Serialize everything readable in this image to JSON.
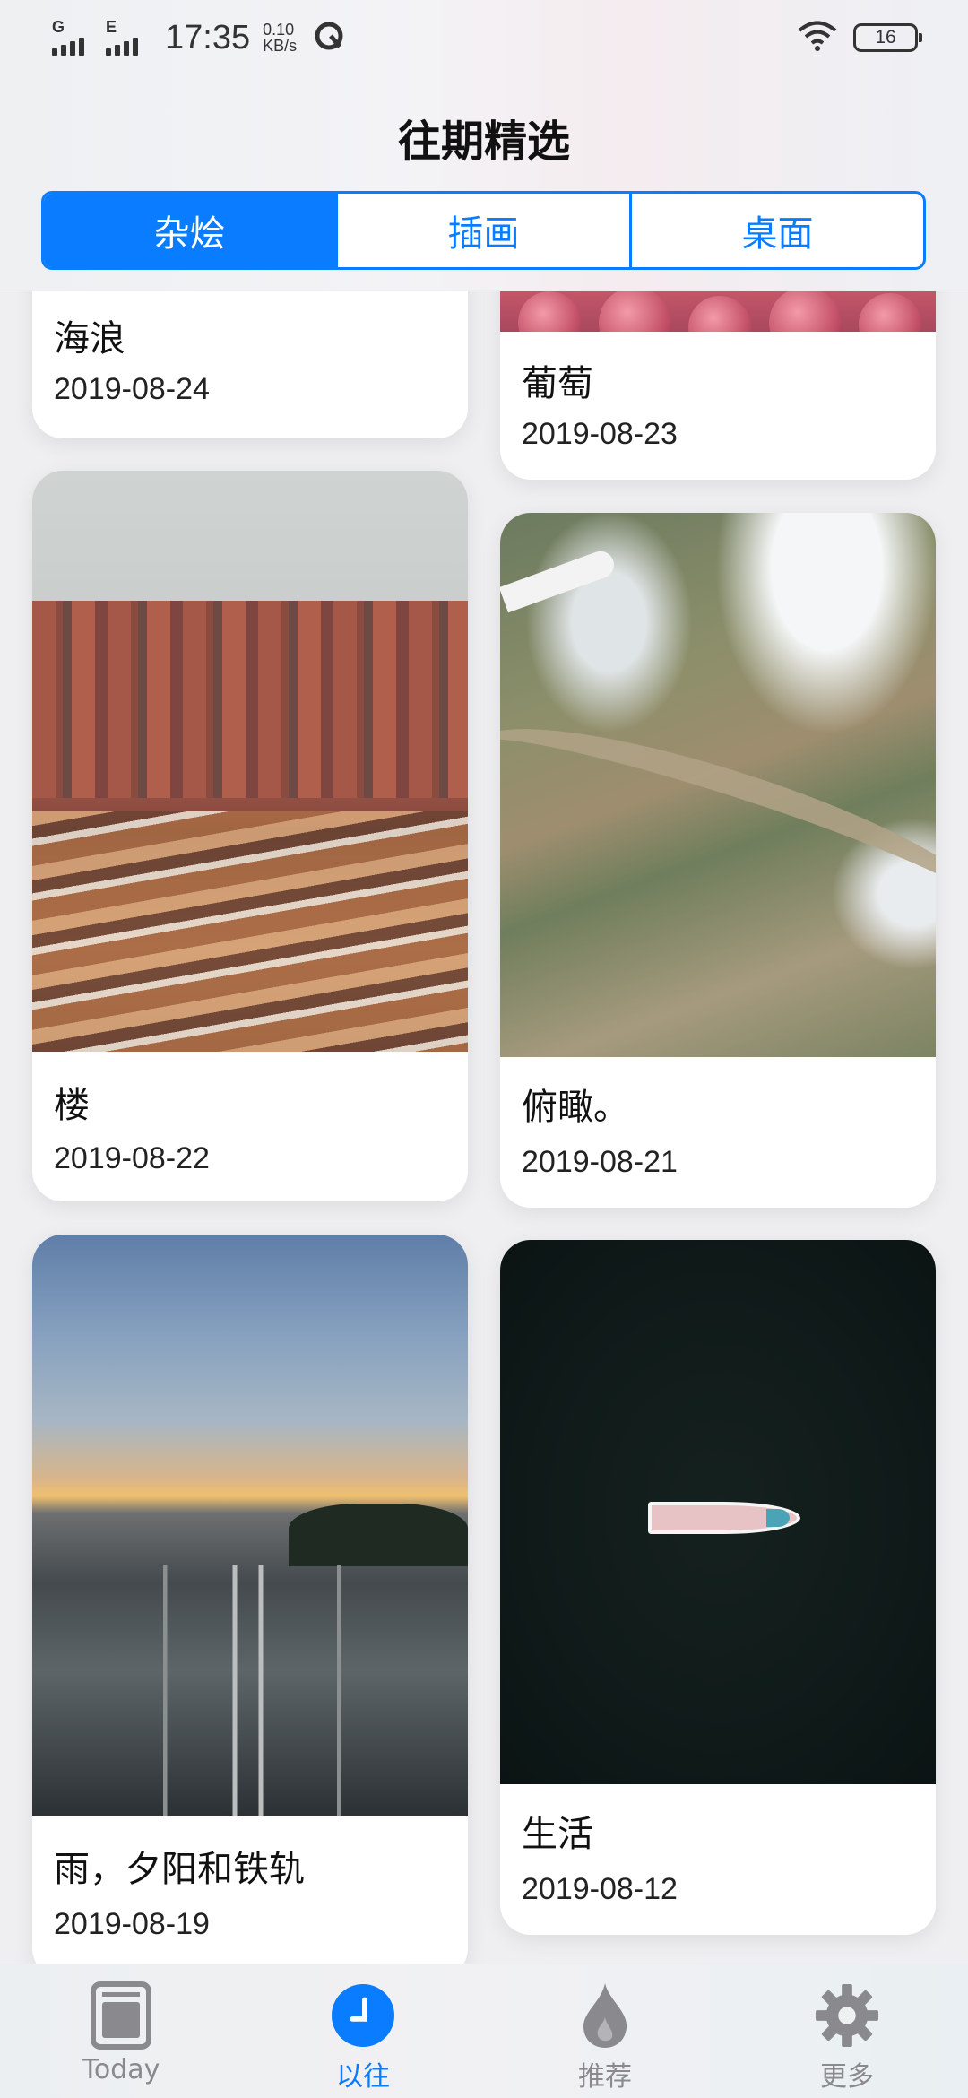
{
  "status_bar": {
    "network_1": "G",
    "network_2": "E",
    "time": "17:35",
    "speed_value": "0.10",
    "speed_unit": "KB/s",
    "battery": "16"
  },
  "header": {
    "title": "往期精选",
    "segments": [
      {
        "label": "杂烩",
        "active": true
      },
      {
        "label": "插画",
        "active": false
      },
      {
        "label": "桌面",
        "active": false
      }
    ]
  },
  "cards": [
    {
      "caption": "海浪",
      "date": "2019-08-24"
    },
    {
      "caption": "葡萄",
      "date": "2019-08-23"
    },
    {
      "caption": "楼",
      "date": "2019-08-22"
    },
    {
      "caption": "俯瞰。",
      "date": "2019-08-21"
    },
    {
      "caption": "雨，夕阳和铁轨",
      "date": "2019-08-19"
    },
    {
      "caption": "生活",
      "date": "2019-08-12"
    }
  ],
  "tabbar": {
    "items": [
      {
        "label": "Today",
        "icon": "today-icon"
      },
      {
        "label": "以往",
        "icon": "clock-icon",
        "active": true
      },
      {
        "label": "推荐",
        "icon": "flame-icon"
      },
      {
        "label": "更多",
        "icon": "gear-icon"
      }
    ]
  },
  "colors": {
    "accent": "#0a7cff",
    "inactive_tab": "#8a8a8e"
  }
}
